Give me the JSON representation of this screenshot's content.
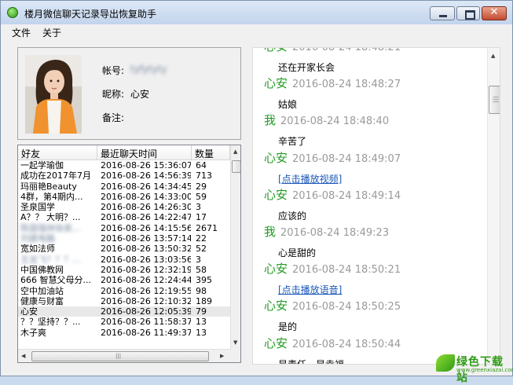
{
  "window": {
    "title": "楼月微信聊天记录导出恢复助手",
    "controls": [
      "minimize",
      "maximize",
      "close"
    ]
  },
  "menu": [
    "文件",
    "关于"
  ],
  "profile": {
    "account_label": "帐号:",
    "account_value": "tyfytyty",
    "nickname_label": "昵称:",
    "nickname_value": "心安",
    "note_label": "备注:"
  },
  "contacts": {
    "columns": [
      "好友",
      "最近聊天时间",
      "数量"
    ],
    "rows": [
      {
        "name": "一起学瑜伽",
        "time": "2016-08-26 15:36:07",
        "count": "64"
      },
      {
        "name": "成功在2017年7月",
        "time": "2016-08-26 14:56:39",
        "count": "713"
      },
      {
        "name": "玛丽艳Beauty",
        "time": "2016-08-26 14:34:45",
        "count": "29"
      },
      {
        "name": "4群，第4期内...",
        "time": "2016-08-26 14:33:00",
        "count": "59"
      },
      {
        "name": "圣泉国学",
        "time": "2016-08-26 14:26:30",
        "count": "3"
      },
      {
        "name": "A？？ 大明？...",
        "time": "2016-08-26 14:22:47",
        "count": "17"
      },
      {
        "name": "陈国强林徐卖...",
        "time": "2016-08-26 14:15:56",
        "count": "2671"
      },
      {
        "name": "刘建电脑",
        "time": "2016-08-26 13:57:14",
        "count": "22"
      },
      {
        "name": "宽如法师",
        "time": "2016-08-26 13:50:32",
        "count": "52"
      },
      {
        "name": "王龙飞？？？...",
        "time": "2016-08-26 13:03:56",
        "count": "3"
      },
      {
        "name": "中国佛教网",
        "time": "2016-08-26 12:32:19",
        "count": "58"
      },
      {
        "name": "666 智慧父母分...",
        "time": "2016-08-26 12:24:44",
        "count": "395"
      },
      {
        "name": "空中加油站",
        "time": "2016-08-26 12:19:55",
        "count": "98"
      },
      {
        "name": "健康与财富",
        "time": "2016-08-26 12:10:32",
        "count": "189"
      },
      {
        "name": "心安",
        "time": "2016-08-26 12:05:39",
        "count": "79"
      },
      {
        "name": "？？坚持？？...",
        "time": "2016-08-26 11:58:37",
        "count": "13"
      },
      {
        "name": "木子爽",
        "time": "2016-08-26 11:49:37",
        "count": "13"
      }
    ]
  },
  "chat": {
    "messages": [
      {
        "sender": "心安",
        "time": "2016-08-24 18:48:21",
        "text": "还在开家长会",
        "link": false
      },
      {
        "sender": "心安",
        "time": "2016-08-24 18:48:27",
        "text": "姑娘",
        "link": false
      },
      {
        "sender": "我",
        "time": "2016-08-24 18:48:40",
        "text": "辛苦了",
        "link": false
      },
      {
        "sender": "心安",
        "time": "2016-08-24 18:49:07",
        "text": "[点击播放视频]",
        "link": true
      },
      {
        "sender": "心安",
        "time": "2016-08-24 18:49:14",
        "text": "应该的",
        "link": false
      },
      {
        "sender": "我",
        "time": "2016-08-24 18:49:23",
        "text": "心是甜的",
        "link": false
      },
      {
        "sender": "心安",
        "time": "2016-08-24 18:50:21",
        "text": "[点击播放语音]",
        "link": true
      },
      {
        "sender": "心安",
        "time": "2016-08-24 18:50:25",
        "text": "是的",
        "link": false
      },
      {
        "sender": "心安",
        "time": "2016-08-24 18:50:44",
        "text": "是责任，是幸福，",
        "link": false
      }
    ]
  },
  "watermark": {
    "text": "绿色下载站",
    "sub": "www.greenxiazai.com"
  },
  "colors": {
    "sender_name": "#239a23",
    "timestamp": "#9a9a9a",
    "link": "#1a57b8",
    "titlebar": "#c2d4ec",
    "selected_row": "#e8e8e8"
  }
}
